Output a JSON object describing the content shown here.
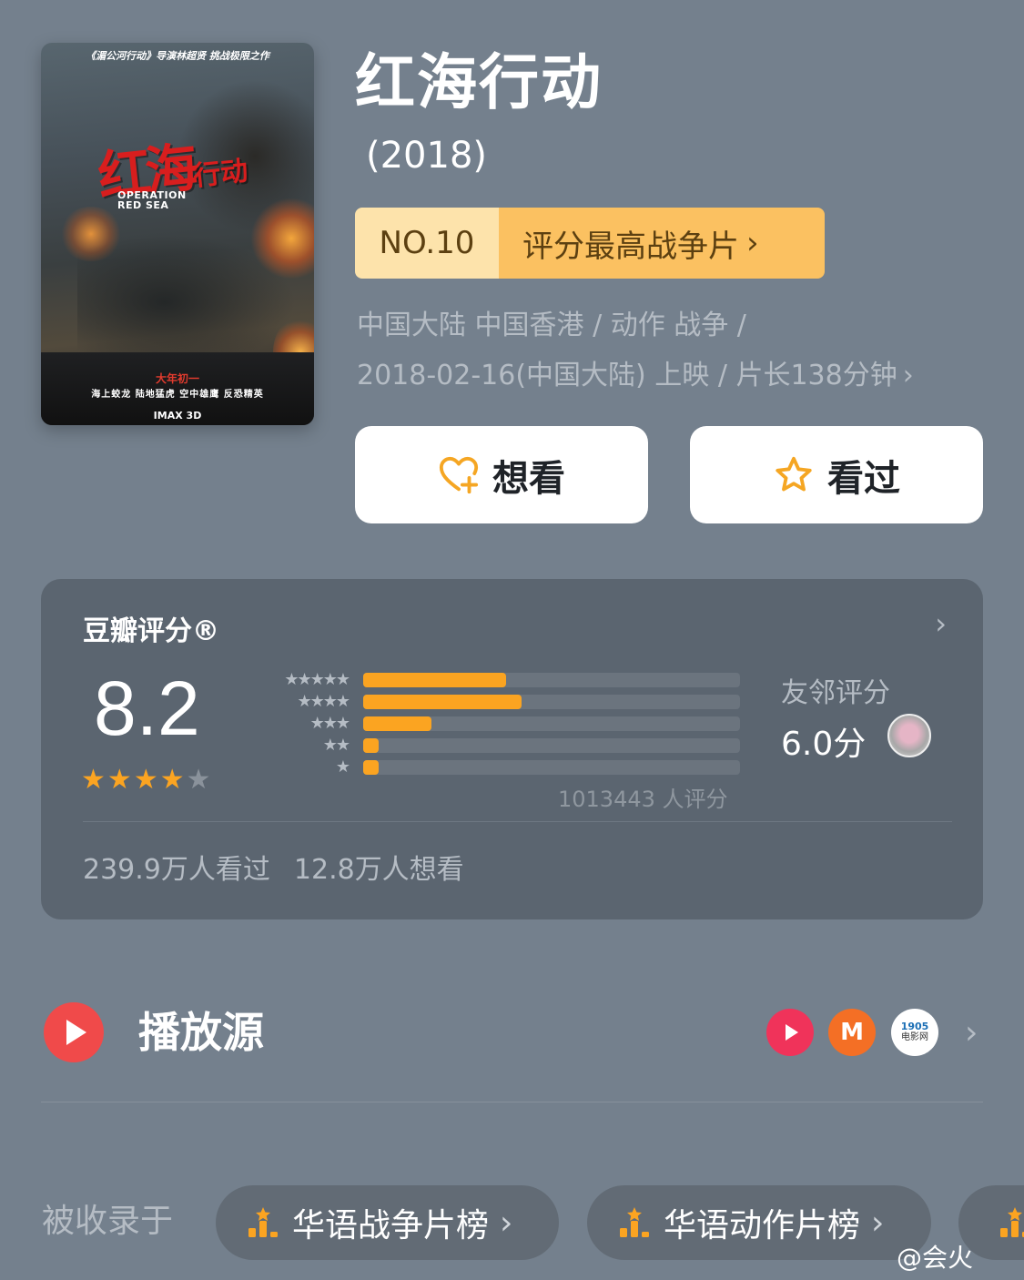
{
  "poster": {
    "tagline": "《湄公河行动》导演林超贤 挑战极限之作",
    "title_art": "红海",
    "title_art_suffix": "行动",
    "english_title": "OPERATION RED SEA",
    "release_note": "大年初一",
    "cast_line": "海上蛟龙 陆地猛虎 空中雄鹰 反恐精英",
    "format": "IMAX 3D"
  },
  "movie": {
    "title": "红海行动",
    "year": "(2018)",
    "rank_no": "NO.10",
    "rank_category": "评分最高战争片",
    "meta_line1": "中国大陆 中国香港 / 动作 战争 /",
    "meta_line2": "2018-02-16(中国大陆) 上映 / 片长138分钟"
  },
  "actions": {
    "want_label": "想看",
    "seen_label": "看过"
  },
  "rating": {
    "label": "豆瓣评分®",
    "score": "8.2",
    "stars": 4,
    "count_text": "1013443 人评分",
    "distribution": [
      {
        "stars": "★★★★★",
        "fraction": 0.38
      },
      {
        "stars": "★★★★",
        "fraction": 0.42
      },
      {
        "stars": "★★★",
        "fraction": 0.18
      },
      {
        "stars": "★★",
        "fraction": 0.04
      },
      {
        "stars": "★",
        "fraction": 0.04
      }
    ],
    "friend_label": "友邻评分",
    "friend_score": "6.0分",
    "seen_count": "239.9万人看过",
    "want_count": "12.8万人想看"
  },
  "sources": {
    "title": "播放源",
    "items": [
      "iqiyi-icon",
      "mgtv-icon",
      "1905-icon"
    ],
    "mgtv_glyph": "M",
    "p1905_top": "1905",
    "p1905_bottom": "电影网"
  },
  "included": {
    "label": "被收录于",
    "lists": [
      "华语战争片榜",
      "华语动作片榜"
    ]
  },
  "watermark": "@会火",
  "colors": {
    "background": "#74808d",
    "accent_orange": "#fba421",
    "rank_badge_light": "#fde3ab",
    "rank_badge": "#fbc161",
    "play_red": "#f04a4a"
  }
}
